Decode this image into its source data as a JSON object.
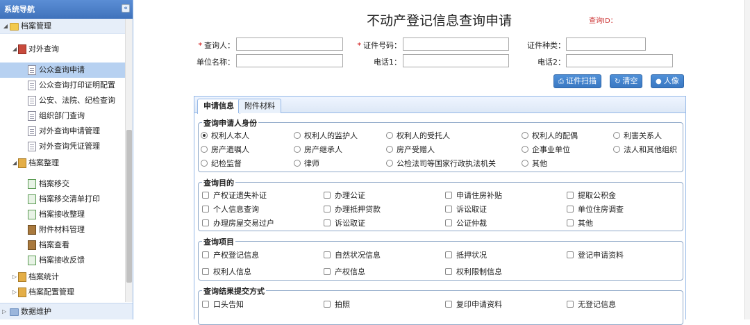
{
  "sidebar": {
    "title": "系统导航",
    "collapse_icon": "«",
    "footer_label": "数据维护",
    "items": [
      {
        "label": "档案管理",
        "name": "sidebar-item-archive-management"
      },
      {
        "label": "对外查询",
        "name": "sidebar-item-external-query"
      },
      {
        "label": "公众查询申请",
        "name": "sidebar-item-public-query-apply"
      },
      {
        "label": "公众查询打印证明配置",
        "name": "sidebar-item-public-query-print-config"
      },
      {
        "label": "公安、法院、纪检查询",
        "name": "sidebar-item-police-court-query"
      },
      {
        "label": "组织部门查询",
        "name": "sidebar-item-org-dept-query"
      },
      {
        "label": "对外查询申请管理",
        "name": "sidebar-item-external-query-apply-mgmt"
      },
      {
        "label": "对外查询凭证管理",
        "name": "sidebar-item-external-query-voucher-mgmt"
      },
      {
        "label": "档案整理",
        "name": "sidebar-item-archive-arrange"
      },
      {
        "label": "档案移交",
        "name": "sidebar-item-archive-transfer"
      },
      {
        "label": "档案移交清单打印",
        "name": "sidebar-item-transfer-list-print"
      },
      {
        "label": "档案接收整理",
        "name": "sidebar-item-archive-receive"
      },
      {
        "label": "附件材料管理",
        "name": "sidebar-item-attachment-mgmt"
      },
      {
        "label": "档案查看",
        "name": "sidebar-item-archive-view"
      },
      {
        "label": "档案接收反馈",
        "name": "sidebar-item-archive-receive-feedback"
      },
      {
        "label": "档案统计",
        "name": "sidebar-item-archive-stats"
      },
      {
        "label": "档案配置管理",
        "name": "sidebar-item-archive-config"
      }
    ]
  },
  "header": {
    "title": "不动产登记信息查询申请",
    "query_id_label": "查询ID："
  },
  "form": {
    "requester_label": "查询人：",
    "id_number_label": "证件号码：",
    "id_type_label": "证件种类：",
    "unit_name_label": "单位名称：",
    "phone1_label": "电话1：",
    "phone2_label": "电话2：",
    "requester_value": "",
    "id_number_value": "",
    "id_type_value": "",
    "unit_name_value": "",
    "phone1_value": "",
    "phone2_value": "",
    "required_mark": "*"
  },
  "toolbar": {
    "scan_label": "证件扫描",
    "clear_label": "清空",
    "portrait_label": "人像"
  },
  "tabs": [
    {
      "label": "申请信息",
      "active": true
    },
    {
      "label": "附件材料",
      "active": false
    }
  ],
  "identity": {
    "title": "查询申请人身份",
    "options": [
      "权利人本人",
      "权利人的监护人",
      "权利人的受托人",
      "权利人的配偶",
      "利害关系人",
      "房产遗嘱人",
      "房产继承人",
      "房产受赠人",
      "企事业单位",
      "法人和其他组织",
      "纪检监督",
      "律师",
      "公检法司等国家行政执法机关",
      "其他"
    ],
    "selected": "权利人本人"
  },
  "purpose": {
    "title": "查询目的",
    "options": [
      "产权证遗失补证",
      "办理公证",
      "申请住房补贴",
      "提取公积金",
      "个人信息查询",
      "办理抵押贷款",
      "诉讼取证",
      "单位住房调查",
      "办理房屋交易过户",
      "诉讼取证",
      "公证仲裁",
      "其他"
    ]
  },
  "items": {
    "title": "查询项目",
    "options": [
      "产权登记信息",
      "自然状况信息",
      "抵押状况",
      "登记申请资料",
      "权利人信息",
      "产权信息",
      "权利限制信息"
    ]
  },
  "delivery": {
    "title": "查询结果提交方式",
    "options": [
      "口头告知",
      "拍照",
      "复印申请资料",
      "无登记信息"
    ]
  },
  "colors": {
    "accent": "#3a78c2",
    "border": "#95b8e7",
    "required": "#cc0000"
  }
}
